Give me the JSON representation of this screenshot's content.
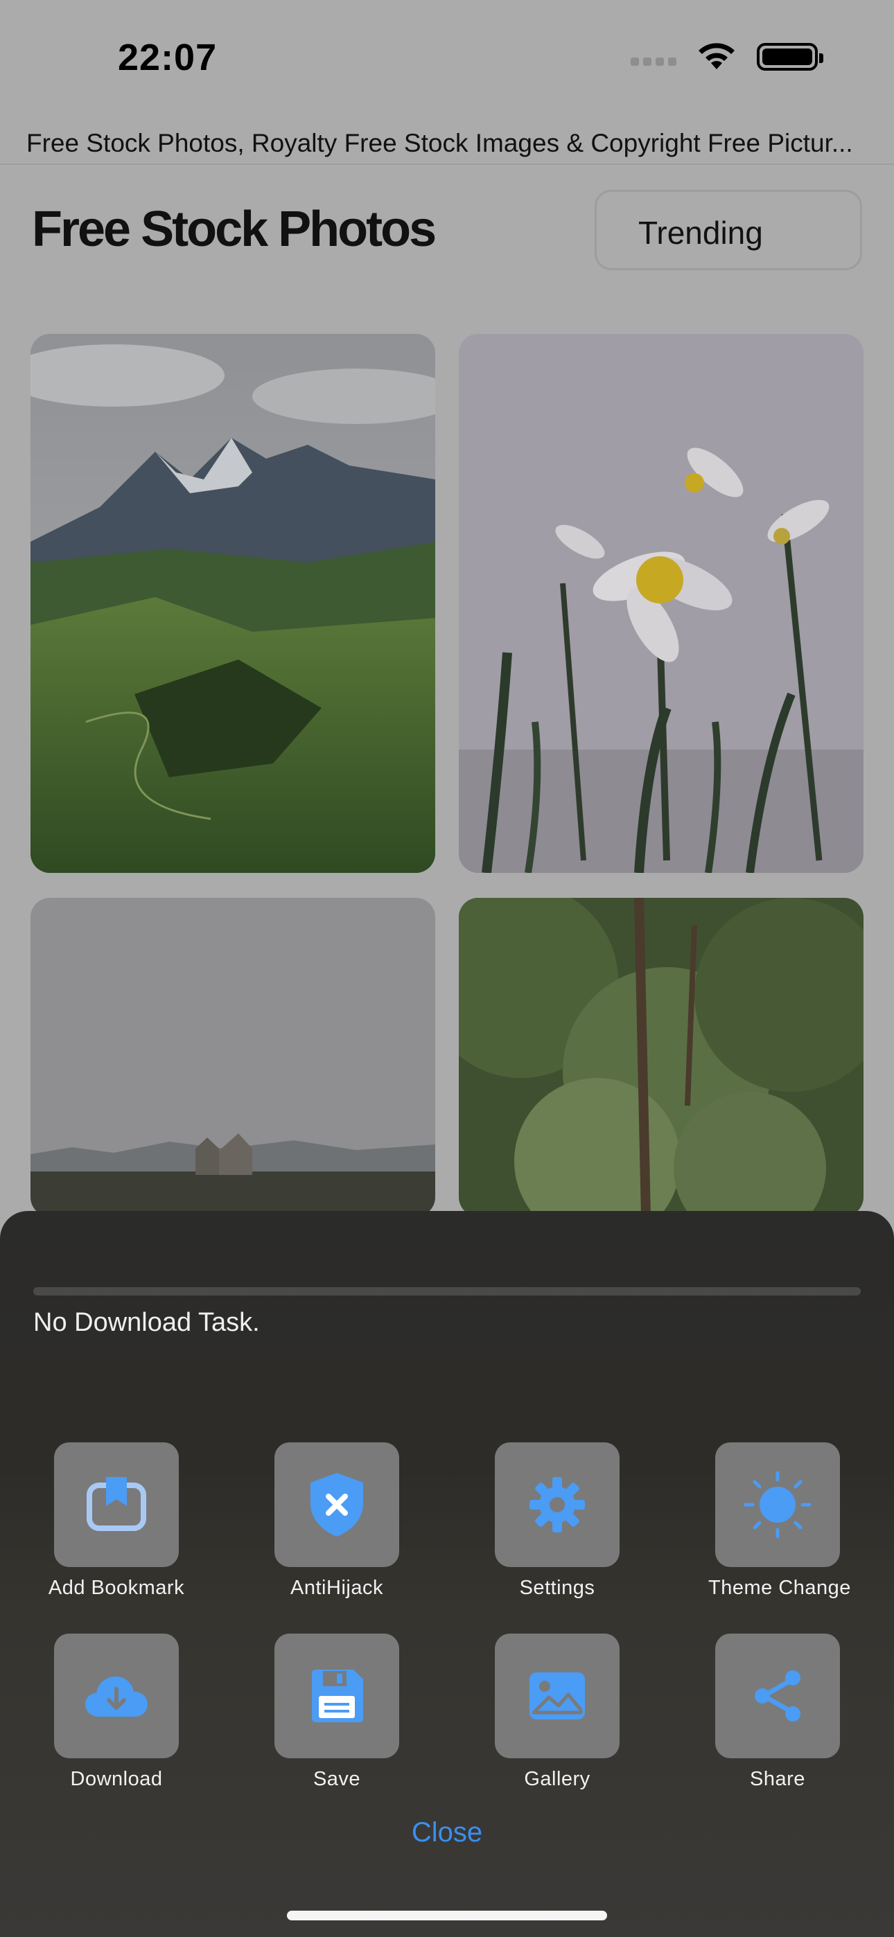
{
  "status_bar": {
    "time": "22:07"
  },
  "browser": {
    "page_title": "Free Stock Photos, Royalty Free Stock Images & Copyright Free Pictur..."
  },
  "site": {
    "logo_text": "Free Stock Photos",
    "sort_select_value": "Trending"
  },
  "gallery": {
    "photos": [
      {
        "subject": "mountain-valley-photo"
      },
      {
        "subject": "daffodil-flowers-photo"
      },
      {
        "subject": "stone-house-landscape-photo"
      },
      {
        "subject": "green-trees-photo"
      }
    ]
  },
  "download_panel": {
    "status_text": "No Download Task.",
    "progress": 0
  },
  "actions": [
    {
      "label": "Add Bookmark",
      "icon": "bookmark-icon"
    },
    {
      "label": "AntiHijack",
      "icon": "shield-x-icon"
    },
    {
      "label": "Settings",
      "icon": "gear-icon"
    },
    {
      "label": "Theme Change",
      "icon": "sun-icon"
    },
    {
      "label": "Download",
      "icon": "cloud-download-icon"
    },
    {
      "label": "Save",
      "icon": "floppy-disk-icon"
    },
    {
      "label": "Gallery",
      "icon": "image-icon"
    },
    {
      "label": "Share",
      "icon": "share-icon"
    }
  ],
  "close_label": "Close",
  "colors": {
    "accent": "#3a8ff0",
    "icon_blue": "#4a9cf5",
    "tile": "#7a7a7a",
    "dim_overlay": "#ababab"
  }
}
